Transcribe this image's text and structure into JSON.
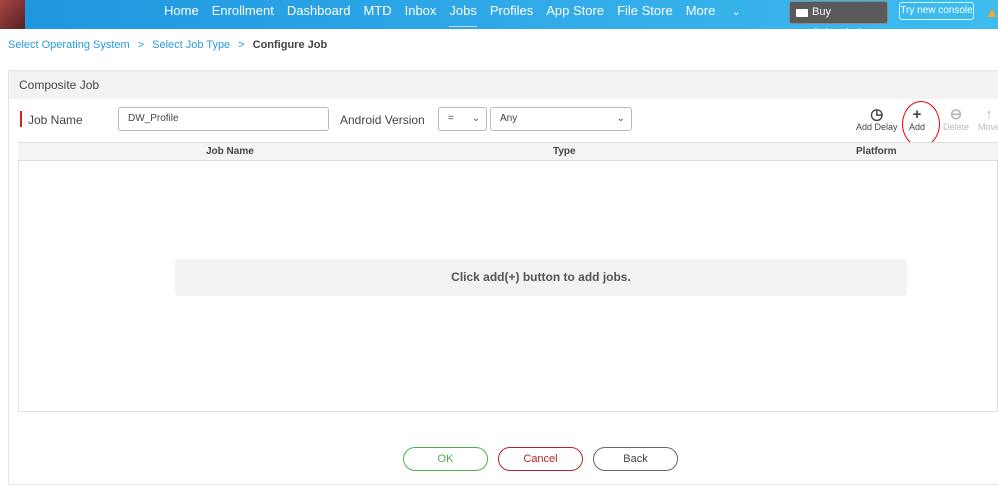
{
  "nav": {
    "items": [
      "Home",
      "Enrollment",
      "Dashboard",
      "MTD",
      "Inbox",
      "Jobs",
      "Profiles",
      "App Store",
      "File Store",
      "More"
    ],
    "active": "Jobs",
    "buy_subscription": "Buy Subscription",
    "try_console": "Try new console"
  },
  "breadcrumb": [
    "Select Operating System",
    "Select Job Type",
    "Configure Job"
  ],
  "panel": {
    "title": "Composite Job",
    "job_name_label": "Job Name",
    "job_name_value": "DW_Profile",
    "android_version_label": "Android Version",
    "operator": "=",
    "version": "Any"
  },
  "toolbar": {
    "add_delay": "Add Delay",
    "add": "Add",
    "delete": "Delete",
    "move": "Move"
  },
  "table": {
    "columns": [
      "Job Name",
      "Type",
      "Platform"
    ],
    "empty_message": "Click add(+) button to add jobs."
  },
  "buttons": {
    "ok": "OK",
    "cancel": "Cancel",
    "back": "Back"
  },
  "colors": {
    "header": "#1e96e0",
    "ok": "#4caf50",
    "cancel": "#b22",
    "annotation": "#e00"
  }
}
